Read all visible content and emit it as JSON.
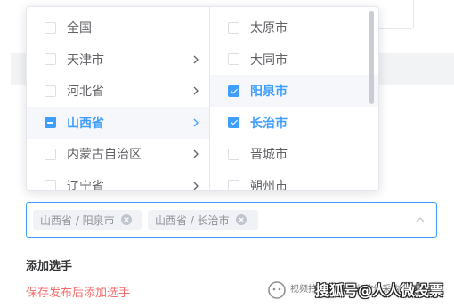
{
  "cascader": {
    "provinces": [
      {
        "label": "全国",
        "state": "unchecked",
        "has_children": false
      },
      {
        "label": "天津市",
        "state": "unchecked",
        "has_children": true
      },
      {
        "label": "河北省",
        "state": "unchecked",
        "has_children": true
      },
      {
        "label": "山西省",
        "state": "indeterminate",
        "has_children": true,
        "active": true
      },
      {
        "label": "内蒙古自治区",
        "state": "unchecked",
        "has_children": true
      },
      {
        "label": "辽宁省",
        "state": "unchecked",
        "has_children": true
      }
    ],
    "cities": [
      {
        "label": "太原市",
        "state": "unchecked"
      },
      {
        "label": "大同市",
        "state": "unchecked"
      },
      {
        "label": "阳泉市",
        "state": "checked"
      },
      {
        "label": "长治市",
        "state": "checked"
      },
      {
        "label": "晋城市",
        "state": "unchecked"
      },
      {
        "label": "朔州市",
        "state": "unchecked"
      }
    ],
    "selected_tags": [
      {
        "label": "山西省 / 阳泉市"
      },
      {
        "label": "山西省 / 长治市"
      }
    ]
  },
  "section": {
    "title": "添加选手",
    "hint": "保存发布后添加选手"
  },
  "watermark": {
    "small_text": "视频拍摄·制作专业软件采购平台",
    "big_text": "搜狐号@人人微投票"
  },
  "colors": {
    "primary": "#409eff",
    "error": "#f56c6c",
    "text": "#606266"
  }
}
